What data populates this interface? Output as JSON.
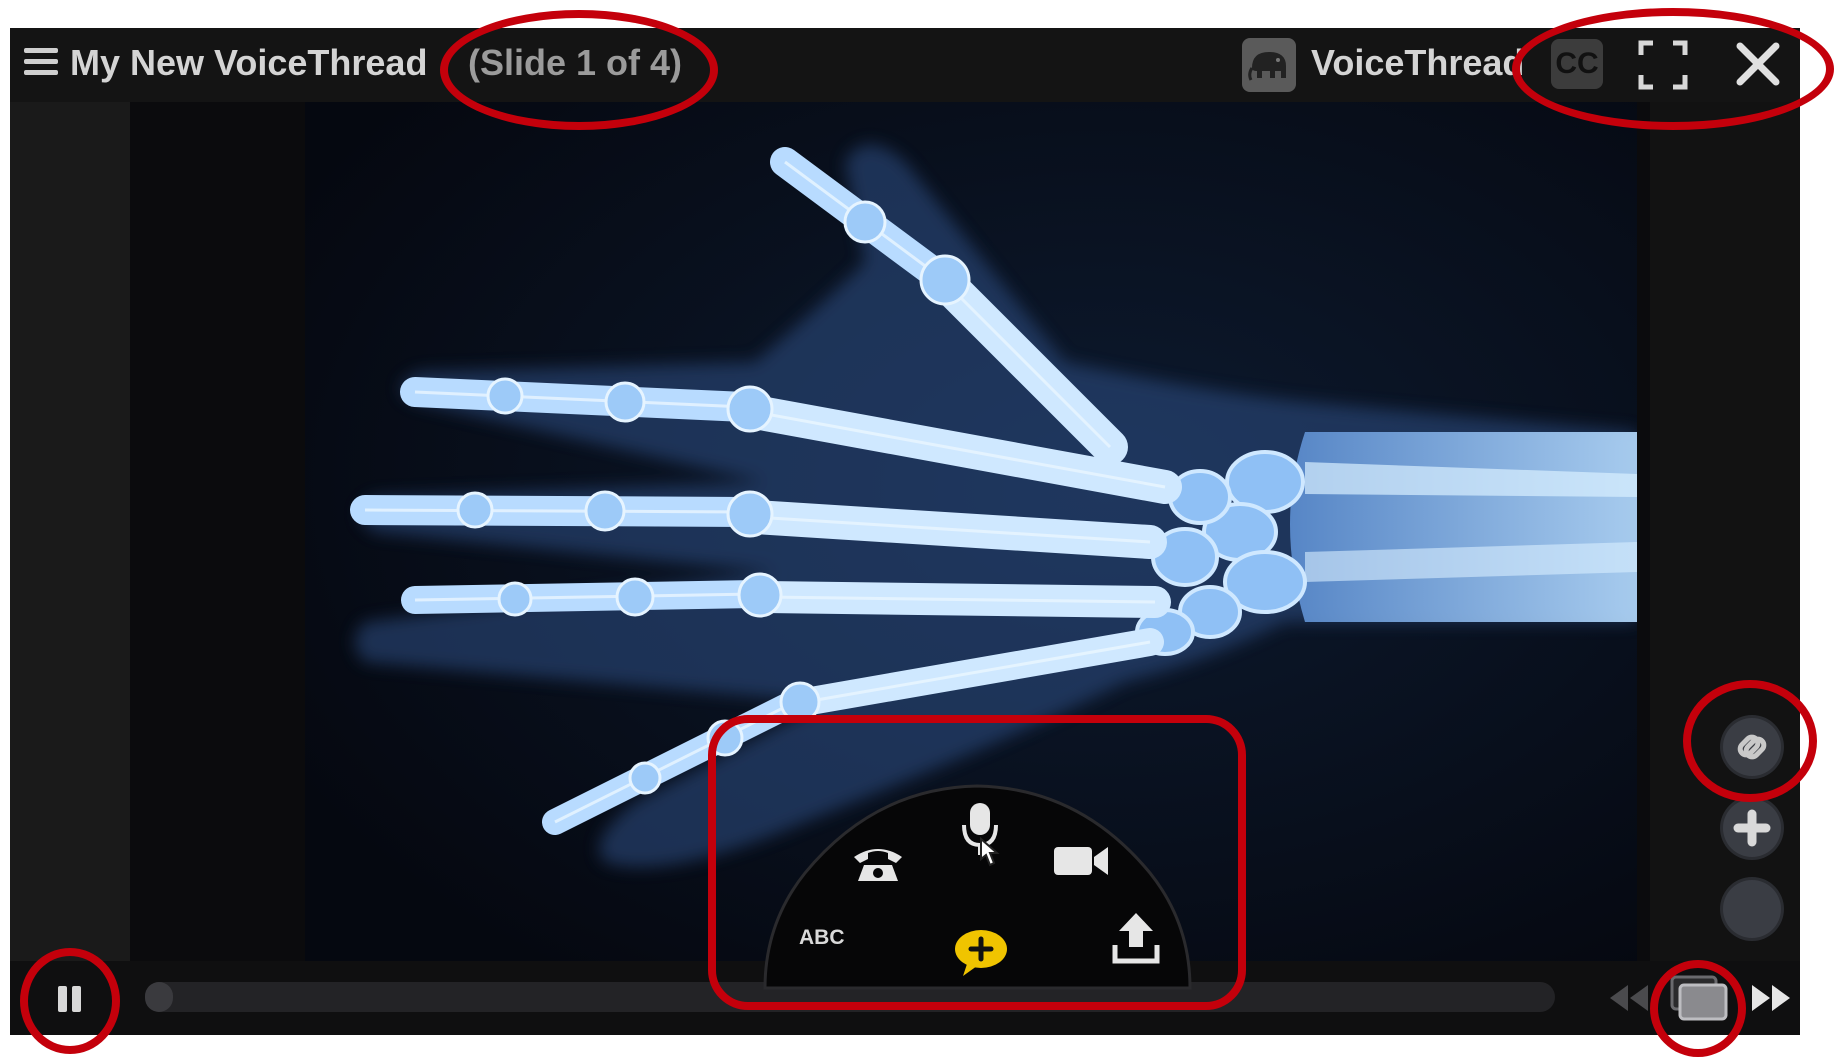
{
  "header": {
    "title": "My New VoiceThread",
    "slide_counter": "(Slide 1 of 4)",
    "brand_name": "VoiceThread",
    "cc_label": "CC"
  },
  "comment_menu": {
    "options": [
      {
        "name": "phone",
        "icon": "telephone-icon"
      },
      {
        "name": "microphone",
        "icon": "microphone-icon"
      },
      {
        "name": "webcam",
        "icon": "video-camera-icon"
      },
      {
        "name": "text",
        "label": "ABC"
      },
      {
        "name": "add-comment",
        "icon": "speech-bubble-plus-icon"
      },
      {
        "name": "upload",
        "icon": "upload-icon"
      }
    ]
  },
  "side_tools": [
    "link-icon",
    "plus-icon",
    "blank-circle-icon"
  ],
  "playback": {
    "state": "playing",
    "progress": 0.02
  },
  "colors": {
    "annotation": "#c4000b",
    "comment_yellow": "#f0c400",
    "xray": "#7fb8ff"
  }
}
